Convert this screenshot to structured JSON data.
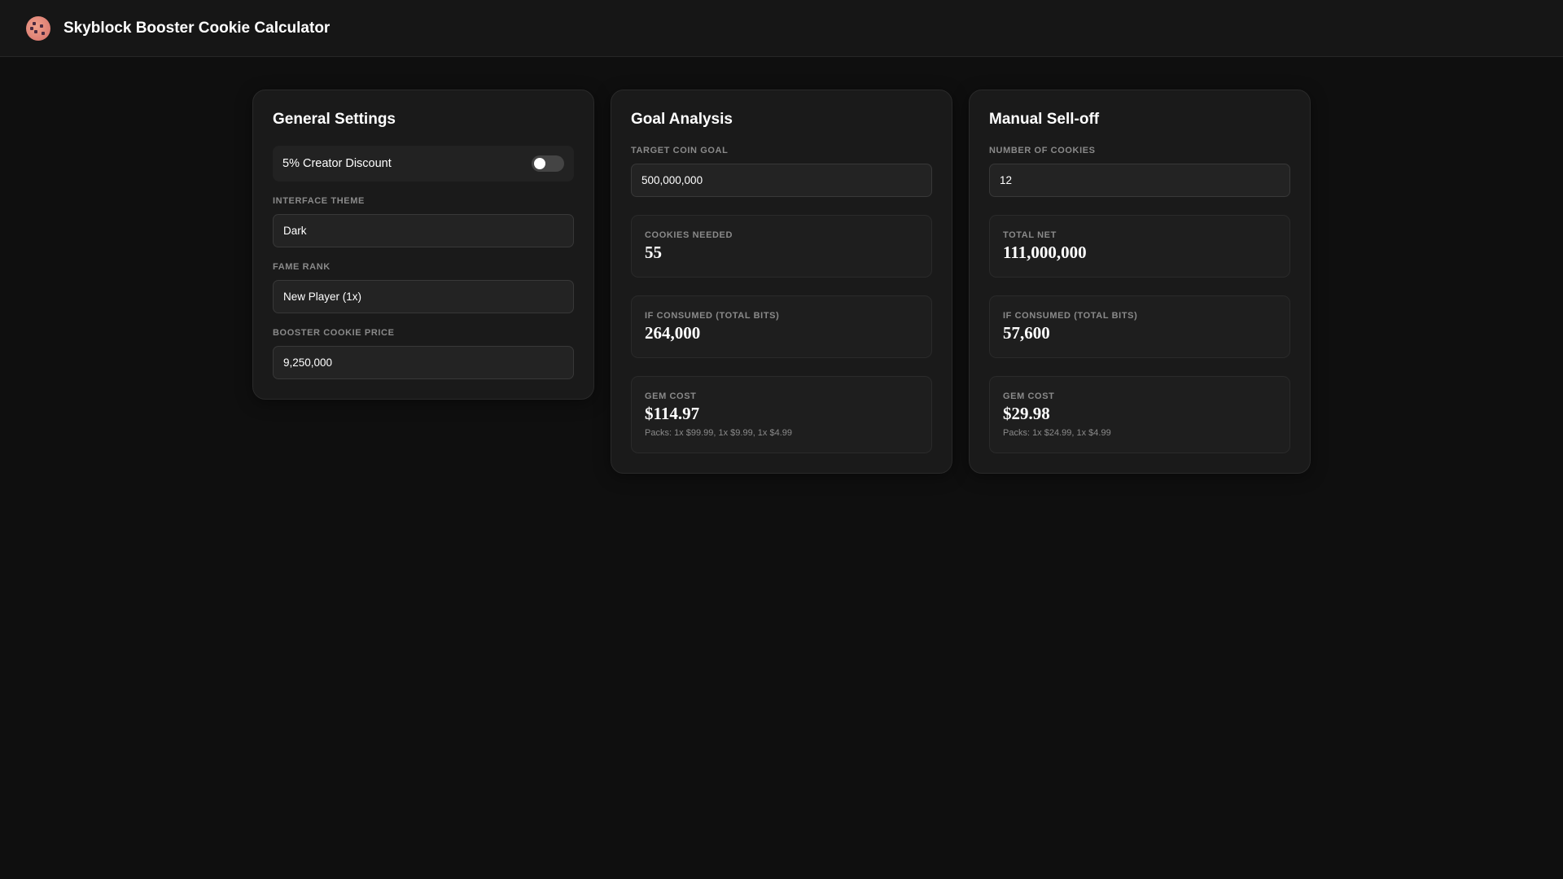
{
  "header": {
    "title": "Skyblock Booster Cookie Calculator",
    "icon": "cookie-icon"
  },
  "general": {
    "title": "General Settings",
    "discount_label": "5% Creator Discount",
    "discount_on": false,
    "theme_label": "INTERFACE THEME",
    "theme_value": "Dark",
    "fame_label": "FAME RANK",
    "fame_value": "New Player (1x)",
    "price_label": "BOOSTER COOKIE PRICE",
    "price_value": "9,250,000"
  },
  "goal": {
    "title": "Goal Analysis",
    "target_label": "TARGET COIN GOAL",
    "target_value": "500,000,000",
    "cookies_label": "COOKIES NEEDED",
    "cookies_value": "55",
    "bits_label": "IF CONSUMED (TOTAL BITS)",
    "bits_value": "264,000",
    "gem_label": "GEM COST",
    "gem_value": "$114.97",
    "packs": "Packs: 1x $99.99, 1x $9.99, 1x $4.99"
  },
  "selloff": {
    "title": "Manual Sell-off",
    "count_label": "NUMBER OF COOKIES",
    "count_value": "12",
    "net_label": "TOTAL NET",
    "net_value": "111,000,000",
    "bits_label": "IF CONSUMED (TOTAL BITS)",
    "bits_value": "57,600",
    "gem_label": "GEM COST",
    "gem_value": "$29.98",
    "packs": "Packs: 1x $24.99, 1x $4.99"
  }
}
